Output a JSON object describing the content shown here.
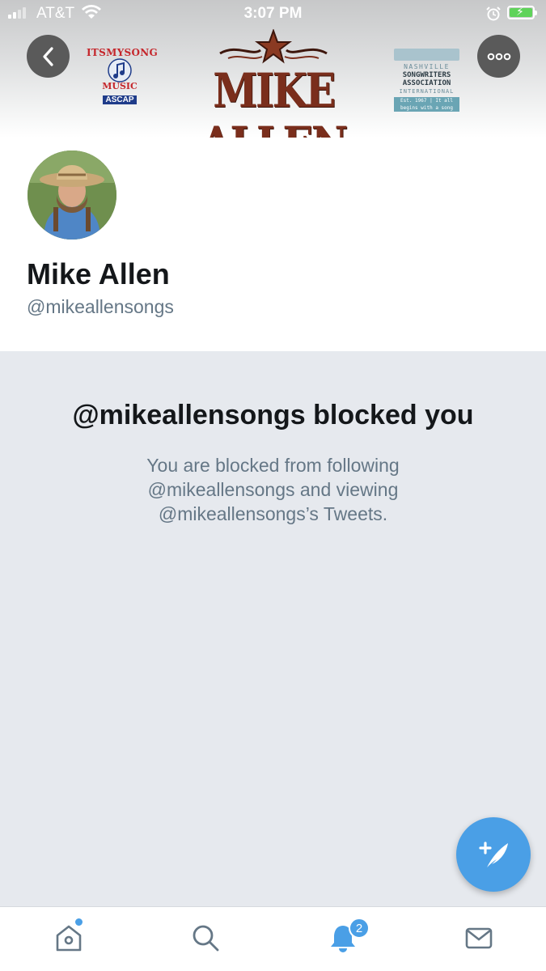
{
  "status_bar": {
    "carrier": "AT&T",
    "time": "3:07 PM",
    "battery_charging": true
  },
  "banner": {
    "logo_left": {
      "line1": "ITSMYSONG",
      "line2": "MUSIC",
      "line3": "ASCAP"
    },
    "logo_center": {
      "title": "MIKE ALLEN"
    },
    "logo_right": {
      "line1": "NASHVILLE",
      "line2": "SONGWRITERS",
      "line3": "ASSOCIATION",
      "line4": "INTERNATIONAL",
      "line5": "Est. 1967 | It all begins with a song"
    },
    "back_icon": "chevron-left-icon",
    "more_icon": "more-dots-icon"
  },
  "profile": {
    "name": "Mike Allen",
    "handle": "@mikeallensongs"
  },
  "blocked": {
    "title": "@mikeallensongs blocked you",
    "description": "You are blocked from following @mikeallensongs and viewing @mikeallensongs’s Tweets."
  },
  "compose": {
    "icon": "compose-tweet-icon"
  },
  "tabbar": {
    "notifications_badge": "2",
    "tabs": [
      "home-icon",
      "search-icon",
      "notifications-icon",
      "messages-icon"
    ]
  },
  "colors": {
    "accent": "#4a9fe6",
    "text_primary": "#14171a",
    "text_secondary": "#657786",
    "blocked_bg": "#e6e9ee"
  }
}
